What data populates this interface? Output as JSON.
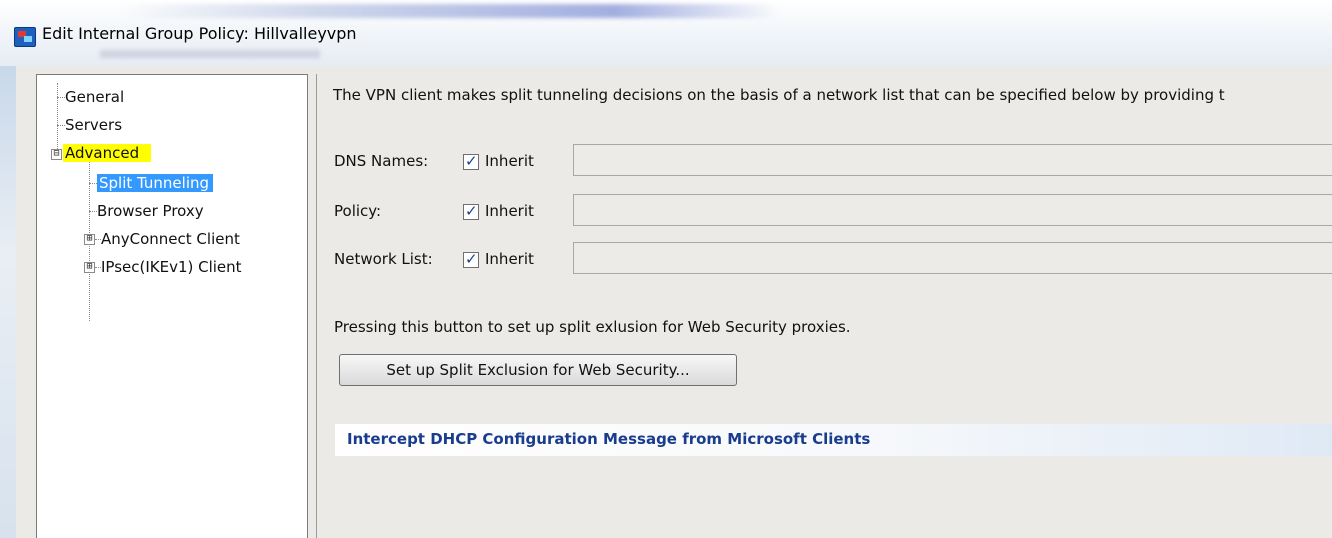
{
  "window": {
    "title": "Edit Internal Group Policy: Hillvalleyvpn"
  },
  "tree": {
    "items": [
      {
        "label": "General"
      },
      {
        "label": "Servers"
      },
      {
        "label": "Advanced",
        "expander": "⊟"
      },
      {
        "label": "Split Tunneling"
      },
      {
        "label": "Browser Proxy"
      },
      {
        "label": "AnyConnect Client",
        "expander": "⊞"
      },
      {
        "label": "IPsec(IKEv1) Client",
        "expander": "⊞"
      }
    ]
  },
  "split_tunneling": {
    "description": "The VPN client makes split tunneling decisions on the basis of a network list that can be specified below by providing t",
    "rows": [
      {
        "label": "DNS Names:",
        "inherit_label": "Inherit",
        "checked": true,
        "value": ""
      },
      {
        "label": "Policy:",
        "inherit_label": "Inherit",
        "checked": true,
        "value": ""
      },
      {
        "label": "Network List:",
        "inherit_label": "Inherit",
        "checked": true,
        "value": ""
      }
    ],
    "exclusion_note": "Pressing this button to set up split exlusion for Web Security proxies.",
    "exclusion_button": "Set up Split Exclusion for Web Security...",
    "dhcp_section_title": "Intercept DHCP Configuration Message from Microsoft Clients"
  },
  "colors": {
    "tree_highlight_yellow": "#ffff00",
    "tree_selection_blue": "#3399ff",
    "section_title_blue": "#1a3c8f"
  }
}
